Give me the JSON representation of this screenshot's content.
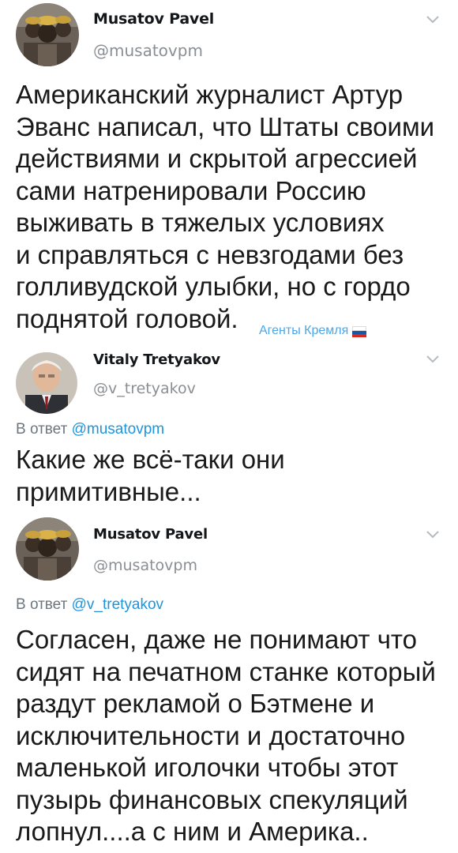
{
  "tweets": [
    {
      "author_name": "Musatov Pavel",
      "handle": "@musatovpm",
      "text": "Американский журналист Артур\nЭванс написал, что Штаты своими\nдействиями и скрытой агрессией\nсами натренировали Россию\nвыживать в тяжелых условиях\nи справляться с невзгодами без\nголливудской улыбки, но с гордо\nподнятой головой."
    },
    {
      "author_name": "Vitaly Tretyakov",
      "handle": "@v_tretyakov",
      "reply_prefix": "В ответ",
      "reply_mention": "@musatovpm",
      "text": "Какие же всё-таки они\nпримитивные..."
    },
    {
      "author_name": "Musatov Pavel",
      "handle": "@musatovpm",
      "reply_prefix": "В ответ",
      "reply_mention": "@v_tretyakov",
      "text": "Согласен, даже не понимают что\nсидят на печатном станке который\nраздут рекламой о Бэтмене и\nисключительности и достаточно\nмаленькой иголочки чтобы этот\nпузырь финансовых спекуляций\nлопнул....а с ним и  Америка.."
    }
  ],
  "watermark": {
    "text": "Агенты Кремля",
    "icon": "russian-flag-icon"
  },
  "colors": {
    "mention": "#1b95e0",
    "handle": "#8a8f94",
    "watermark": "#4aa7e8"
  }
}
